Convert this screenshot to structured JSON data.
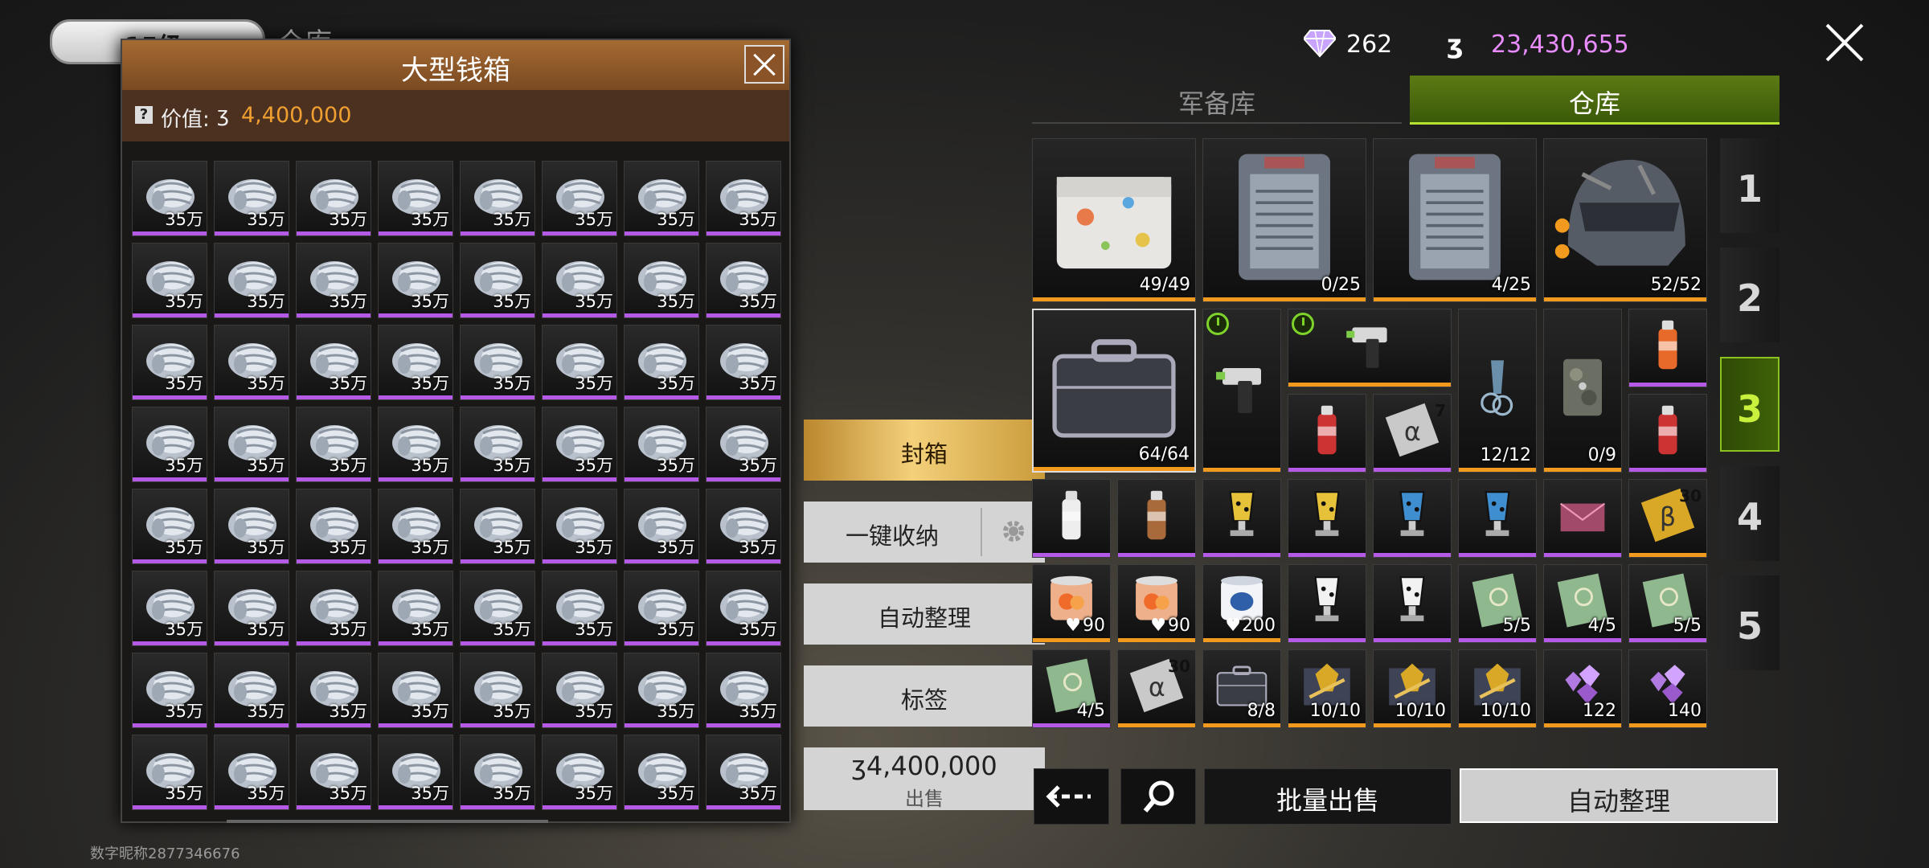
{
  "background": {
    "warehouse_label": "仓库",
    "watermark": "数字昵称2877346676",
    "level_text": "15级"
  },
  "money_box": {
    "title": "大型钱箱",
    "value_label": "价值:",
    "value_amount": "4,400,000",
    "cash_label": "35万",
    "cash_count": 64,
    "rarity_color": "#b45ae6"
  },
  "actions": {
    "seal": "封箱",
    "one_click_stash": "一键收纳",
    "auto_sort": "自动整理",
    "tag": "标签",
    "sell_amount": "4,400,000",
    "sell_label": "出售"
  },
  "currency": {
    "gems": "262",
    "coins": "23,430,655"
  },
  "tabs": {
    "armory": "军备库",
    "warehouse": "仓库"
  },
  "pages": [
    "1",
    "2",
    "3",
    "4",
    "5"
  ],
  "active_page": "3",
  "inventory": [
    {
      "name": "paint-splash-crate",
      "count": "49/49",
      "rarity": "orange"
    },
    {
      "name": "steel-locker-a",
      "count": "0/25",
      "rarity": "orange"
    },
    {
      "name": "steel-locker-b",
      "count": "4/25",
      "rarity": "orange"
    },
    {
      "name": "tactical-helmet",
      "count": "52/52",
      "rarity": "orange"
    },
    {
      "name": "hard-case",
      "count": "64/64",
      "rarity": "orange"
    },
    {
      "name": "nail-gun-a",
      "count": "",
      "rarity": "orange"
    },
    {
      "name": "nail-gun-b",
      "count": "",
      "rarity": "orange"
    },
    {
      "name": "carabiner-keychain",
      "count": "12/12",
      "rarity": "orange"
    },
    {
      "name": "camo-wallet",
      "count": "0/9",
      "rarity": "orange"
    },
    {
      "name": "spray-can-orange",
      "count": "",
      "rarity": "purple"
    },
    {
      "name": "spray-can-red",
      "count": "",
      "rarity": "purple"
    },
    {
      "name": "spray-can-red-2",
      "count": "",
      "rarity": "purple"
    },
    {
      "name": "alpha-card-7",
      "count": "",
      "rarity": "purple",
      "badge": "7"
    },
    {
      "name": "spray-white",
      "count": "",
      "rarity": "purple"
    },
    {
      "name": "spray-bronze",
      "count": "",
      "rarity": "purple"
    },
    {
      "name": "trophy-yellow-a",
      "count": "",
      "rarity": "purple"
    },
    {
      "name": "trophy-yellow-b",
      "count": "",
      "rarity": "purple"
    },
    {
      "name": "trophy-blue-a",
      "count": "",
      "rarity": "purple"
    },
    {
      "name": "trophy-blue-b",
      "count": "",
      "rarity": "purple"
    },
    {
      "name": "envelope",
      "count": "",
      "rarity": "purple"
    },
    {
      "name": "beta-card-30",
      "count": "",
      "rarity": "orange",
      "badge": "30"
    },
    {
      "name": "peach-can-a",
      "count": "90",
      "rarity": "orange",
      "heart": true
    },
    {
      "name": "peach-can-b",
      "count": "90",
      "rarity": "orange",
      "heart": true
    },
    {
      "name": "milk-can",
      "count": "200",
      "rarity": "orange",
      "heart": true
    },
    {
      "name": "trophy-white-a",
      "count": "",
      "rarity": "purple"
    },
    {
      "name": "trophy-white-b",
      "count": "",
      "rarity": "purple"
    },
    {
      "name": "green-card-a",
      "count": "5/5",
      "rarity": "purple"
    },
    {
      "name": "green-card-b",
      "count": "4/5",
      "rarity": "purple"
    },
    {
      "name": "green-card-c",
      "count": "5/5",
      "rarity": "purple"
    },
    {
      "name": "green-card-d",
      "count": "4/5",
      "rarity": "purple"
    },
    {
      "name": "alpha-card-30",
      "count": "",
      "rarity": "orange",
      "badge": "30"
    },
    {
      "name": "black-case",
      "count": "8/8",
      "rarity": "orange"
    },
    {
      "name": "gold-emblem-a",
      "count": "10/10",
      "rarity": "orange"
    },
    {
      "name": "gold-emblem-b",
      "count": "10/10",
      "rarity": "orange"
    },
    {
      "name": "gold-emblem-c",
      "count": "10/10",
      "rarity": "orange"
    },
    {
      "name": "purple-gems-a",
      "count": "122",
      "rarity": "orange"
    },
    {
      "name": "purple-gems-b",
      "count": "140",
      "rarity": "orange"
    }
  ],
  "bottom": {
    "bulk_sell": "批量出售",
    "auto_sort": "自动整理"
  },
  "colors": {
    "orange_rarity": "#f29a1e",
    "purple_rarity": "#b45ae6",
    "active_green": "#b7e234",
    "coin_pink": "#e98cff"
  }
}
